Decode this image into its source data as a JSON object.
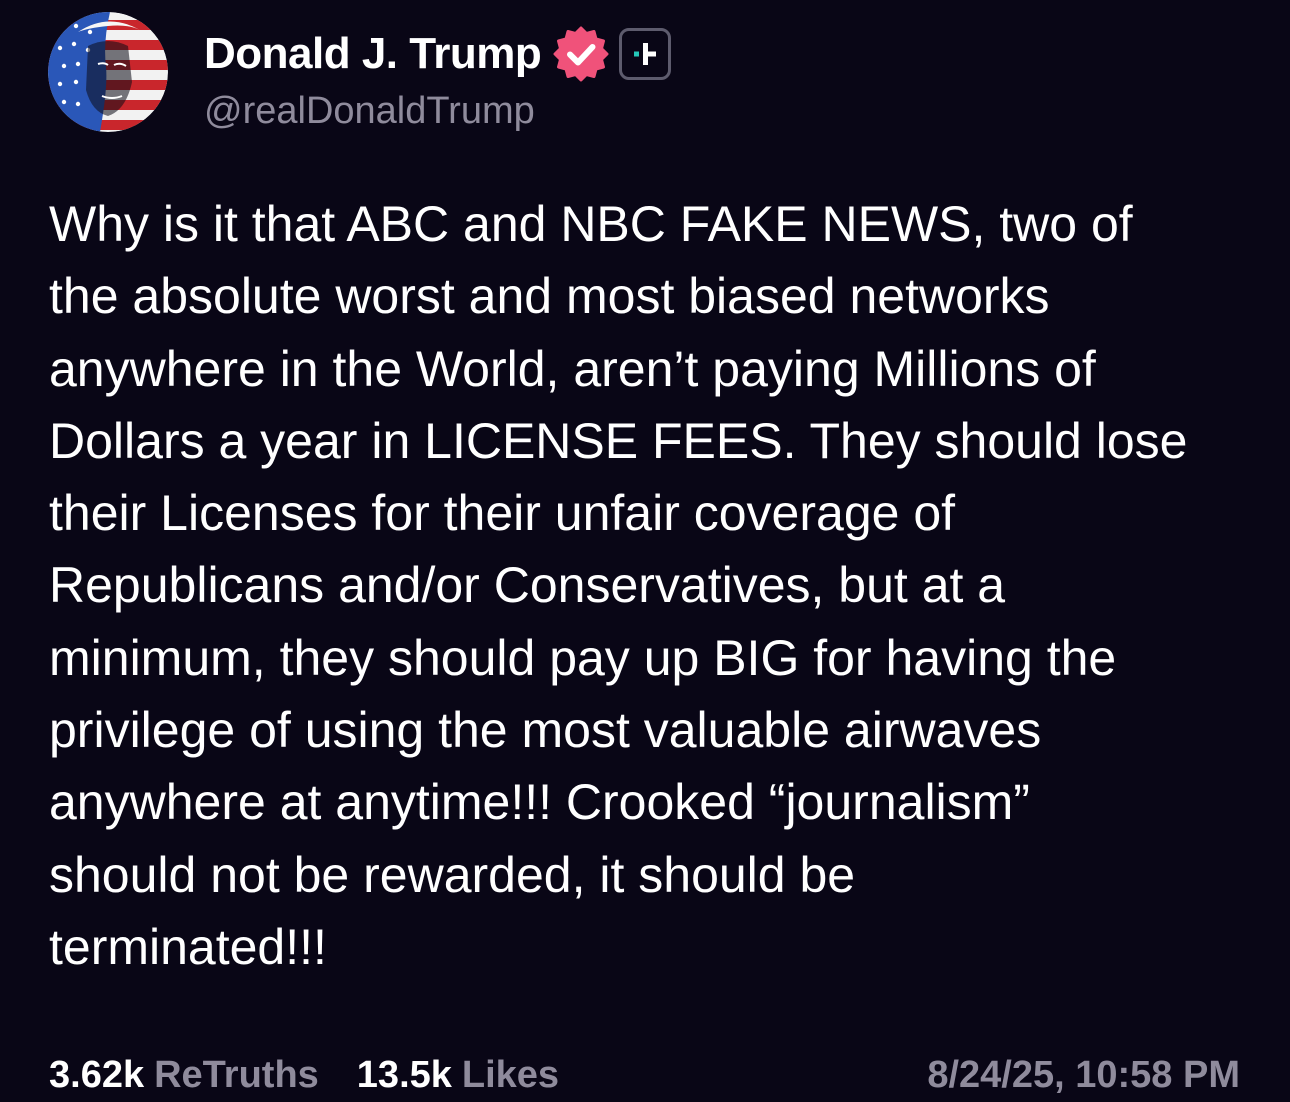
{
  "author": {
    "display_name": "Donald J. Trump",
    "handle": "@realDonaldTrump",
    "avatar_icon": "flag-portrait-avatar",
    "verified_icon": "verified-badge-icon",
    "plus_icon": "plus-badge-icon"
  },
  "post": {
    "text": "Why is it that ABC and NBC FAKE NEWS, two of\nthe absolute worst and most biased networks\nanywhere in the World, aren’t paying Millions of\nDollars a year in LICENSE FEES. They should lose\ntheir Licenses for their unfair coverage of\nRepublicans and/or Conservatives, but at a\nminimum, they should pay up BIG for having the\nprivilege of using the most valuable airwaves\nanywhere at anytime!!! Crooked “journalism”\nshould not be rewarded, it should be\nterminated!!!"
  },
  "stats": {
    "retruths_count": "3.62k",
    "retruths_label": "ReTruths",
    "likes_count": "13.5k",
    "likes_label": "Likes",
    "timestamp": "8/24/25, 10:58 PM"
  },
  "colors": {
    "background": "#090616",
    "text": "#ffffff",
    "muted": "#8f8b9c",
    "verified": "#f0527a",
    "plus_accent": "#25c7b8"
  }
}
